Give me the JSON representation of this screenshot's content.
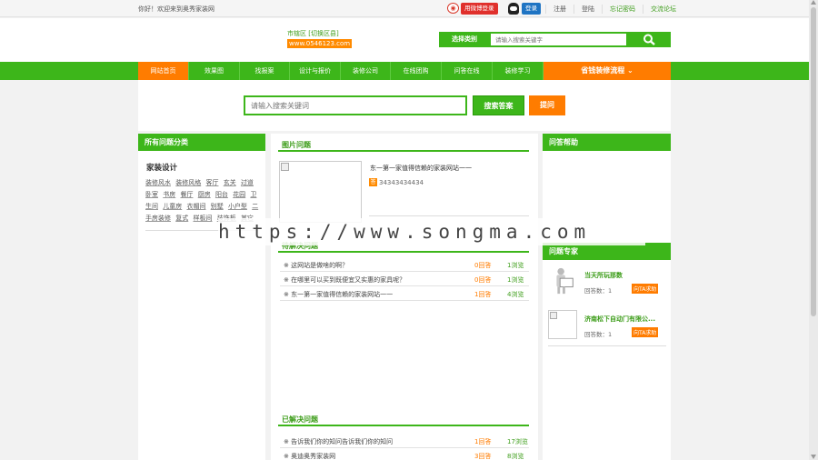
{
  "topbar": {
    "welcome": "你好！欢迎来到奥秀家装网",
    "weibo_login": "用微博登录",
    "qq_login": "登录",
    "links": [
      "注册",
      "登陆",
      "忘记密码",
      "交流论坛"
    ]
  },
  "header": {
    "city": "市辖区 [切换区县]",
    "url": "www.0546123.com",
    "search_select": "选择类别",
    "search_placeholder": "请输入搜索关键字"
  },
  "nav": {
    "items": [
      "网站首页",
      "效果图",
      "找报案",
      "设计与报价",
      "装修公司",
      "在线团购",
      "问答在线",
      "装修学习"
    ],
    "featured": "省钱装修流程"
  },
  "qa_search": {
    "placeholder": "请输入搜索关键词",
    "search_button": "搜索答案",
    "ask_button": "提问"
  },
  "left": {
    "title": "所有问题分类",
    "category": "家装设计",
    "tags": [
      "装修风水",
      "装修风格",
      "客厅",
      "玄关",
      "过道",
      "卧室",
      "书房",
      "餐厅",
      "厨房",
      "阳台",
      "花园",
      "卫生间",
      "儿童房",
      "衣帽间",
      "别墅",
      "小户型",
      "二手房装修",
      "复式",
      "样板间",
      "装饰板",
      "其它"
    ]
  },
  "mid": {
    "pic_title": "图片问题",
    "pic_item_title": "东一第一家值得信赖的家装网站一一",
    "pic_item_badge": "答",
    "pic_item_num": "34343434434",
    "unsolved_title": "待解决问题",
    "unsolved": [
      {
        "title": "这网站是做啥的啊？",
        "answers": "0回答",
        "views": "1浏览"
      },
      {
        "title": "在哪里可以买到既便宜又实惠的家具呢？",
        "answers": "0回答",
        "views": "1浏览"
      },
      {
        "title": "东一第一家值得信赖的家装网站一一",
        "answers": "1回答",
        "views": "4浏览"
      }
    ],
    "solved_title": "已解决问题",
    "solved": [
      {
        "title": "告诉我们你的知问告诉我们你的知问",
        "answers": "1回答",
        "views": "17浏览"
      },
      {
        "title": "奥迪奥秀家装网",
        "answers": "3回答",
        "views": "8浏览"
      }
    ]
  },
  "right": {
    "help_title": "问答帮助",
    "experts_title": "问题专家",
    "experts": [
      {
        "name": "当天所玩那数",
        "count": "回答数：1",
        "ask": "向TA求助"
      },
      {
        "name": "济南松下自动门有限公...",
        "count": "回答数：1",
        "ask": "向TA求助"
      }
    ]
  },
  "watermark": "https://www.songma.com"
}
